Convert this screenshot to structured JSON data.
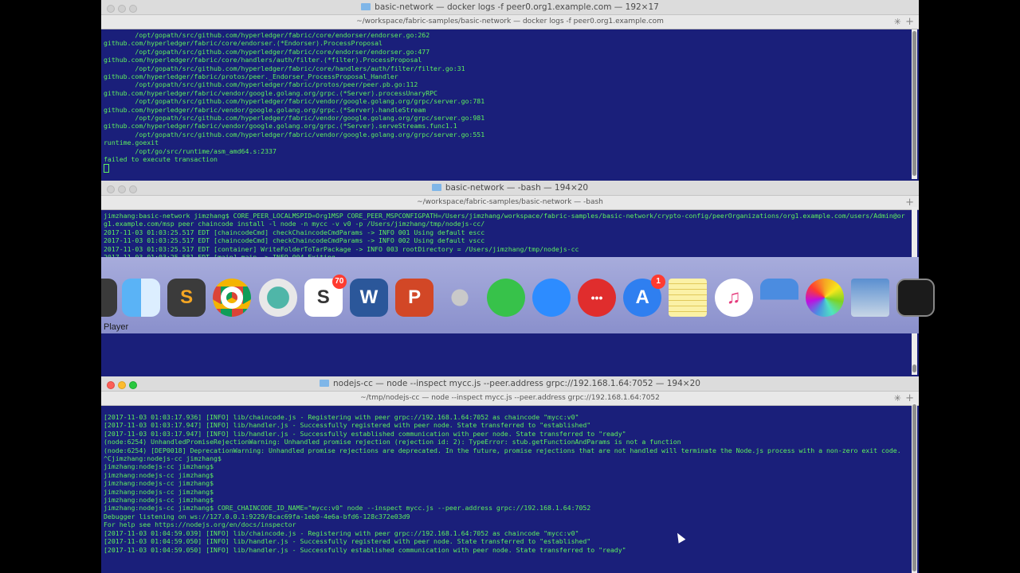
{
  "window1": {
    "title": "basic-network — docker logs -f peer0.org1.example.com — 192×17",
    "tab": "~/workspace/fabric-samples/basic-network — docker logs -f peer0.org1.example.com",
    "lines": [
      "        /opt/gopath/src/github.com/hyperledger/fabric/core/endorser/endorser.go:262",
      "github.com/hyperledger/fabric/core/endorser.(*Endorser).ProcessProposal",
      "        /opt/gopath/src/github.com/hyperledger/fabric/core/endorser/endorser.go:477",
      "github.com/hyperledger/fabric/core/handlers/auth/filter.(*filter).ProcessProposal",
      "        /opt/gopath/src/github.com/hyperledger/fabric/core/handlers/auth/filter/filter.go:31",
      "github.com/hyperledger/fabric/protos/peer._Endorser_ProcessProposal_Handler",
      "        /opt/gopath/src/github.com/hyperledger/fabric/protos/peer/peer.pb.go:112",
      "github.com/hyperledger/fabric/vendor/google.golang.org/grpc.(*Server).processUnaryRPC",
      "        /opt/gopath/src/github.com/hyperledger/fabric/vendor/google.golang.org/grpc/server.go:781",
      "github.com/hyperledger/fabric/vendor/google.golang.org/grpc.(*Server).handleStream",
      "        /opt/gopath/src/github.com/hyperledger/fabric/vendor/google.golang.org/grpc/server.go:981",
      "github.com/hyperledger/fabric/vendor/google.golang.org/grpc.(*Server).serveStreams.func1.1",
      "        /opt/gopath/src/github.com/hyperledger/fabric/vendor/google.golang.org/grpc/server.go:551",
      "runtime.goexit",
      "        /opt/go/src/runtime/asm_amd64.s:2337",
      "failed to execute transaction"
    ]
  },
  "window2": {
    "title": "basic-network — -bash — 194×20",
    "tab": "~/workspace/fabric-samples/basic-network — -bash",
    "lines": [
      "jimzhang:basic-network jimzhang$ CORE_PEER_LOCALMSPID=Org1MSP CORE_PEER_MSPCONFIGPATH=/Users/jimzhang/workspace/fabric-samples/basic-network/crypto-config/peerOrganizations/org1.example.com/users/Admin@org1.example.com/msp peer chaincode install -l node -n mycc -v v0 -p /Users/jimzhang/tmp/nodejs-cc/",
      "2017-11-03 01:03:25.517 EDT [chaincodeCmd] checkChaincodeCmdParams -> INFO 001 Using default escc",
      "2017-11-03 01:03:25.517 EDT [chaincodeCmd] checkChaincodeCmdParams -> INFO 002 Using default vscc",
      "2017-11-03 01:03:25.517 EDT [container] WriteFolderToTarPackage -> INFO 003 rootDirectory = /Users/jimzhang/tmp/nodejs-cc",
      "2017-11-03 01:03:25.581 EDT [main] main -> INFO 004 Exiting....."
    ]
  },
  "dock": {
    "hover_label": "Player",
    "apps": [
      {
        "name": "player-icon",
        "glyph": ""
      },
      {
        "name": "finder-icon",
        "glyph": ""
      },
      {
        "name": "sublime-text-icon",
        "glyph": "S"
      },
      {
        "name": "chrome-icon",
        "glyph": ""
      },
      {
        "name": "network-app-icon",
        "glyph": ""
      },
      {
        "name": "slack-icon",
        "glyph": "S",
        "badge": "70"
      },
      {
        "name": "word-icon",
        "glyph": "W"
      },
      {
        "name": "powerpoint-icon",
        "glyph": "P"
      },
      {
        "name": "keychain-icon",
        "glyph": ""
      },
      {
        "name": "cloud-app-icon",
        "glyph": ""
      },
      {
        "name": "zoom-icon",
        "glyph": ""
      },
      {
        "name": "speech-bubble-app-icon",
        "glyph": "•••"
      },
      {
        "name": "app-store-icon",
        "glyph": "A",
        "badge": "1"
      },
      {
        "name": "notes-icon",
        "glyph": ""
      },
      {
        "name": "itunes-icon",
        "glyph": "♫"
      },
      {
        "name": "keynote-icon",
        "glyph": ""
      },
      {
        "name": "photos-icon",
        "glyph": ""
      },
      {
        "name": "preview-icon",
        "glyph": ""
      },
      {
        "name": "activity-monitor-icon",
        "glyph": ""
      }
    ]
  },
  "window3": {
    "title": "nodejs-cc — node --inspect mycc.js --peer.address grpc://192.168.1.64:7052 — 194×20",
    "tab": "~/tmp/nodejs-cc — node --inspect mycc.js --peer.address grpc://192.168.1.64:7052",
    "lines": [
      "[2017-11-03 01:03:17.936] [INFO] lib/chaincode.js - Registering with peer grpc://192.168.1.64:7052 as chaincode \"mycc:v0\"",
      "[2017-11-03 01:03:17.947] [INFO] lib/handler.js - Successfully registered with peer node. State transferred to \"established\"",
      "[2017-11-03 01:03:17.947] [INFO] lib/handler.js - Successfully established communication with peer node. State transferred to \"ready\"",
      "(node:6254) UnhandledPromiseRejectionWarning: Unhandled promise rejection (rejection id: 2): TypeError: stub.getFunctionAndParams is not a function",
      "(node:6254) [DEP0018] DeprecationWarning: Unhandled promise rejections are deprecated. In the future, promise rejections that are not handled will terminate the Node.js process with a non-zero exit code.",
      "^Cjimzhang:nodejs-cc jimzhang$",
      "jimzhang:nodejs-cc jimzhang$",
      "jimzhang:nodejs-cc jimzhang$",
      "jimzhang:nodejs-cc jimzhang$",
      "jimzhang:nodejs-cc jimzhang$",
      "jimzhang:nodejs-cc jimzhang$",
      "jimzhang:nodejs-cc jimzhang$ CORE_CHAINCODE_ID_NAME=\"mycc:v0\" node --inspect mycc.js --peer.address grpc://192.168.1.64:7052",
      "Debugger listening on ws://127.0.0.1:9229/8cac69fa-1eb0-4e6a-bfd6-128c372e03d9",
      "For help see https://nodejs.org/en/docs/inspector",
      "[2017-11-03 01:04:59.039] [INFO] lib/chaincode.js - Registering with peer grpc://192.168.1.64:7052 as chaincode \"mycc:v0\"",
      "[2017-11-03 01:04:59.050] [INFO] lib/handler.js - Successfully registered with peer node. State transferred to \"established\"",
      "[2017-11-03 01:04:59.050] [INFO] lib/handler.js - Successfully established communication with peer node. State transferred to \"ready\""
    ]
  },
  "colors": {
    "terminal_bg": "#1a1f7a",
    "terminal_fg": "#5ef05e"
  }
}
